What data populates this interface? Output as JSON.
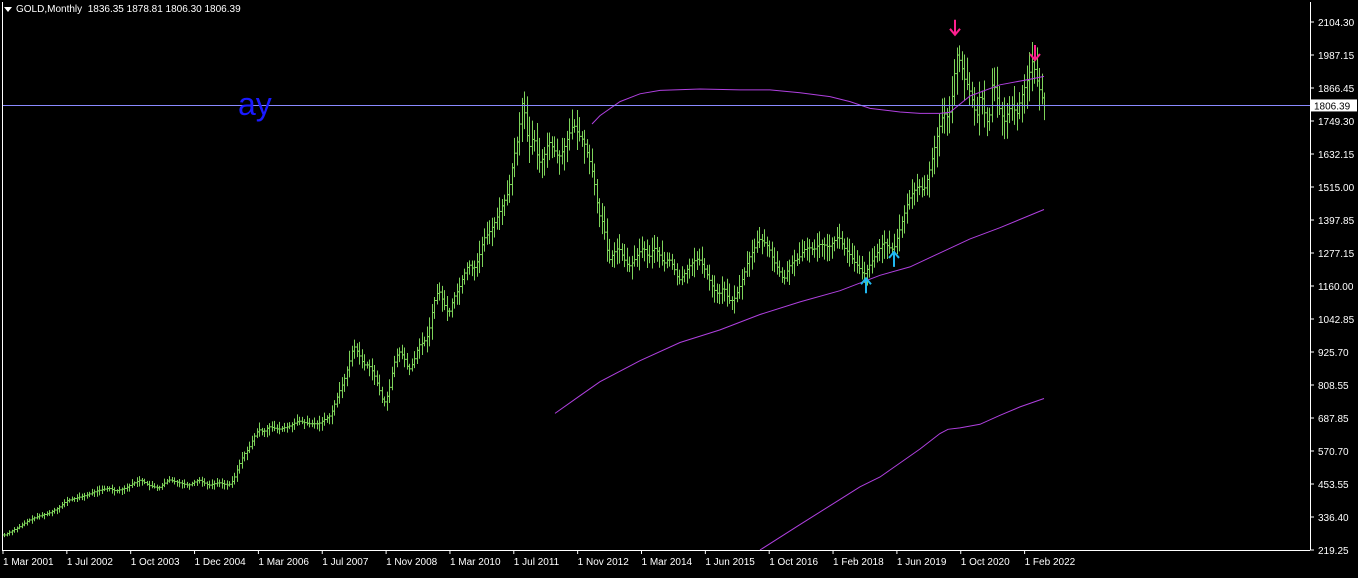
{
  "header": {
    "symbol_timeframe": "GOLD,Monthly",
    "ohlc": "1836.35 1878.81 1806.30 1806.39"
  },
  "overlay_text": "ay",
  "colors": {
    "background": "#000000",
    "bars": "#7dd35a",
    "moving_average": "#b040e0",
    "price_line": "#8a8aff",
    "sell_arrow": "#ff1f8f",
    "buy_arrow": "#20b8f0",
    "axis": "#ffffff",
    "overlay_text": "#1a1aff"
  },
  "chart_data": {
    "type": "ohlc_bar",
    "current_price": 1806.39,
    "current_price_label": "1806.39",
    "ylim": [
      219.25,
      2160
    ],
    "y_tick_labels": [
      "2104.30",
      "1987.15",
      "1866.45",
      "1749.30",
      "1632.15",
      "1515.00",
      "1397.85",
      "1277.15",
      "1160.00",
      "1042.85",
      "925.70",
      "808.55",
      "687.85",
      "570.70",
      "453.55",
      "336.40",
      "219.25"
    ],
    "x_tick_labels": [
      "1 Mar 2001",
      "1 Jul 2002",
      "1 Oct 2003",
      "1 Dec 2004",
      "1 Mar 2006",
      "1 Jul 2007",
      "1 Nov 2008",
      "1 Mar 2010",
      "1 Jul 2011",
      "1 Nov 2012",
      "1 Mar 2014",
      "1 Jun 2015",
      "1 Oct 2016",
      "1 Feb 2018",
      "1 Jun 2019",
      "1 Oct 2020",
      "1 Feb 2022"
    ],
    "close_anchors": [
      [
        0,
        265
      ],
      [
        10,
        285
      ],
      [
        18,
        300
      ],
      [
        28,
        325
      ],
      [
        38,
        340
      ],
      [
        48,
        350
      ],
      [
        58,
        370
      ],
      [
        66,
        395
      ],
      [
        76,
        405
      ],
      [
        86,
        415
      ],
      [
        96,
        430
      ],
      [
        108,
        440
      ],
      [
        115,
        430
      ],
      [
        120,
        435
      ],
      [
        125,
        440
      ],
      [
        130,
        452
      ],
      [
        140,
        470
      ],
      [
        148,
        450
      ],
      [
        158,
        440
      ],
      [
        168,
        470
      ],
      [
        178,
        460
      ],
      [
        188,
        450
      ],
      [
        198,
        470
      ],
      [
        208,
        450
      ],
      [
        218,
        460
      ],
      [
        228,
        450
      ],
      [
        233,
        470
      ],
      [
        238,
        520
      ],
      [
        243,
        560
      ],
      [
        248,
        580
      ],
      [
        253,
        620
      ],
      [
        258,
        650
      ],
      [
        263,
        640
      ],
      [
        268,
        660
      ],
      [
        278,
        650
      ],
      [
        288,
        660
      ],
      [
        298,
        680
      ],
      [
        308,
        670
      ],
      [
        318,
        670
      ],
      [
        330,
        700
      ],
      [
        338,
        780
      ],
      [
        343,
        820
      ],
      [
        348,
        880
      ],
      [
        353,
        950
      ],
      [
        358,
        920
      ],
      [
        363,
        880
      ],
      [
        368,
        880
      ],
      [
        373,
        850
      ],
      [
        378,
        800
      ],
      [
        383,
        740
      ],
      [
        388,
        780
      ],
      [
        393,
        880
      ],
      [
        398,
        930
      ],
      [
        403,
        910
      ],
      [
        408,
        860
      ],
      [
        413,
        890
      ],
      [
        418,
        950
      ],
      [
        423,
        960
      ],
      [
        428,
        990
      ],
      [
        433,
        1100
      ],
      [
        438,
        1150
      ],
      [
        443,
        1100
      ],
      [
        448,
        1060
      ],
      [
        453,
        1120
      ],
      [
        458,
        1150
      ],
      [
        463,
        1200
      ],
      [
        468,
        1240
      ],
      [
        473,
        1220
      ],
      [
        478,
        1260
      ],
      [
        483,
        1330
      ],
      [
        488,
        1350
      ],
      [
        493,
        1380
      ],
      [
        498,
        1420
      ],
      [
        503,
        1460
      ],
      [
        508,
        1500
      ],
      [
        513,
        1620
      ],
      [
        518,
        1700
      ],
      [
        521,
        1820
      ],
      [
        524,
        1780
      ],
      [
        528,
        1650
      ],
      [
        533,
        1700
      ],
      [
        538,
        1600
      ],
      [
        543,
        1620
      ],
      [
        548,
        1680
      ],
      [
        553,
        1650
      ],
      [
        558,
        1620
      ],
      [
        563,
        1650
      ],
      [
        568,
        1700
      ],
      [
        573,
        1740
      ],
      [
        578,
        1700
      ],
      [
        583,
        1680
      ],
      [
        588,
        1620
      ],
      [
        593,
        1550
      ],
      [
        598,
        1420
      ],
      [
        603,
        1380
      ],
      [
        608,
        1250
      ],
      [
        613,
        1280
      ],
      [
        618,
        1300
      ],
      [
        623,
        1260
      ],
      [
        628,
        1230
      ],
      [
        633,
        1250
      ],
      [
        638,
        1280
      ],
      [
        643,
        1300
      ],
      [
        648,
        1260
      ],
      [
        653,
        1300
      ],
      [
        658,
        1280
      ],
      [
        663,
        1240
      ],
      [
        668,
        1260
      ],
      [
        673,
        1230
      ],
      [
        678,
        1180
      ],
      [
        683,
        1200
      ],
      [
        688,
        1230
      ],
      [
        693,
        1250
      ],
      [
        698,
        1260
      ],
      [
        703,
        1230
      ],
      [
        708,
        1190
      ],
      [
        713,
        1150
      ],
      [
        718,
        1130
      ],
      [
        723,
        1160
      ],
      [
        728,
        1110
      ],
      [
        733,
        1110
      ],
      [
        738,
        1150
      ],
      [
        743,
        1200
      ],
      [
        748,
        1260
      ],
      [
        753,
        1290
      ],
      [
        758,
        1330
      ],
      [
        763,
        1320
      ],
      [
        768,
        1300
      ],
      [
        773,
        1250
      ],
      [
        778,
        1220
      ],
      [
        783,
        1180
      ],
      [
        788,
        1230
      ],
      [
        793,
        1250
      ],
      [
        798,
        1260
      ],
      [
        803,
        1290
      ],
      [
        808,
        1300
      ],
      [
        813,
        1290
      ],
      [
        818,
        1310
      ],
      [
        823,
        1310
      ],
      [
        828,
        1300
      ],
      [
        833,
        1320
      ],
      [
        838,
        1340
      ],
      [
        843,
        1300
      ],
      [
        848,
        1280
      ],
      [
        853,
        1250
      ],
      [
        858,
        1230
      ],
      [
        863,
        1200
      ],
      [
        868,
        1230
      ],
      [
        873,
        1260
      ],
      [
        878,
        1290
      ],
      [
        883,
        1320
      ],
      [
        888,
        1300
      ],
      [
        893,
        1290
      ],
      [
        898,
        1350
      ],
      [
        903,
        1410
      ],
      [
        908,
        1470
      ],
      [
        913,
        1500
      ],
      [
        918,
        1520
      ],
      [
        923,
        1500
      ],
      [
        928,
        1560
      ],
      [
        933,
        1640
      ],
      [
        938,
        1720
      ],
      [
        943,
        1780
      ],
      [
        948,
        1760
      ],
      [
        952,
        1850
      ],
      [
        956,
        1990
      ],
      [
        960,
        1960
      ],
      [
        964,
        1900
      ],
      [
        968,
        1870
      ],
      [
        972,
        1820
      ],
      [
        976,
        1760
      ],
      [
        980,
        1860
      ],
      [
        984,
        1780
      ],
      [
        988,
        1730
      ],
      [
        992,
        1900
      ],
      [
        996,
        1840
      ],
      [
        1000,
        1780
      ],
      [
        1004,
        1750
      ],
      [
        1008,
        1790
      ],
      [
        1012,
        1810
      ],
      [
        1016,
        1770
      ],
      [
        1020,
        1830
      ],
      [
        1024,
        1870
      ],
      [
        1028,
        1910
      ],
      [
        1032,
        1970
      ],
      [
        1036,
        1900
      ],
      [
        1040,
        1850
      ],
      [
        1044,
        1806
      ]
    ],
    "ma_fast": [
      [
        592,
        1740
      ],
      [
        600,
        1770
      ],
      [
        620,
        1820
      ],
      [
        640,
        1848
      ],
      [
        660,
        1860
      ],
      [
        700,
        1865
      ],
      [
        740,
        1862
      ],
      [
        770,
        1862
      ],
      [
        800,
        1852
      ],
      [
        830,
        1838
      ],
      [
        850,
        1820
      ],
      [
        870,
        1796
      ],
      [
        900,
        1783
      ],
      [
        920,
        1778
      ],
      [
        940,
        1778
      ],
      [
        950,
        1782
      ],
      [
        970,
        1840
      ],
      [
        1000,
        1880
      ],
      [
        1030,
        1900
      ],
      [
        1044,
        1910
      ]
    ],
    "ma_mid": [
      [
        555,
        707
      ],
      [
        580,
        770
      ],
      [
        600,
        820
      ],
      [
        640,
        895
      ],
      [
        680,
        960
      ],
      [
        720,
        1005
      ],
      [
        760,
        1060
      ],
      [
        800,
        1105
      ],
      [
        840,
        1145
      ],
      [
        880,
        1200
      ],
      [
        910,
        1230
      ],
      [
        940,
        1280
      ],
      [
        970,
        1330
      ],
      [
        1000,
        1370
      ],
      [
        1044,
        1435
      ]
    ],
    "ma_slow": [
      [
        760,
        219.25
      ],
      [
        800,
        310
      ],
      [
        840,
        400
      ],
      [
        860,
        445
      ],
      [
        880,
        480
      ],
      [
        900,
        530
      ],
      [
        920,
        580
      ],
      [
        940,
        635
      ],
      [
        948,
        650
      ],
      [
        960,
        655
      ],
      [
        980,
        668
      ],
      [
        1000,
        700
      ],
      [
        1020,
        730
      ],
      [
        1044,
        760
      ]
    ],
    "sell_arrows": [
      [
        955,
        2080
      ],
      [
        1035,
        1990
      ]
    ],
    "buy_arrows": [
      [
        866,
        1168
      ],
      [
        894,
        1262
      ]
    ]
  }
}
